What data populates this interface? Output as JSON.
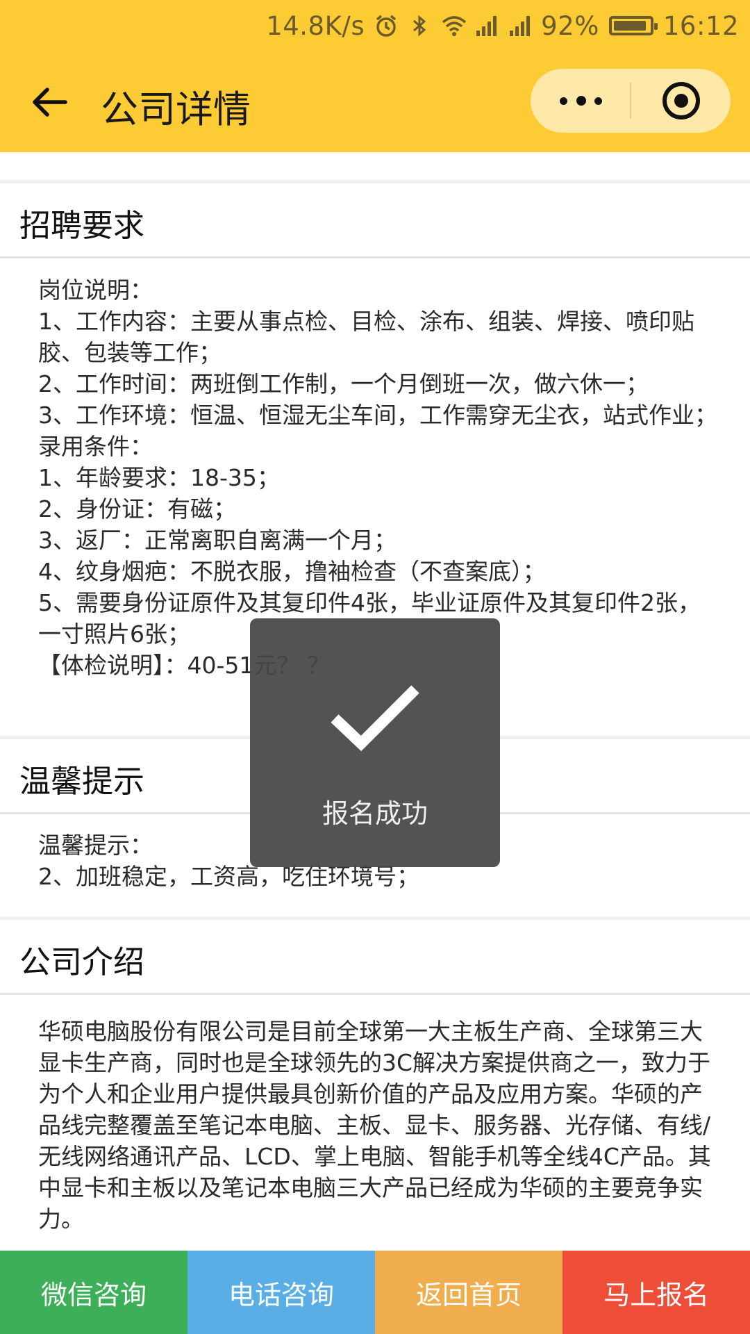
{
  "status_bar": {
    "speed": "14.8K/s",
    "battery": "92%",
    "battery_level": 0.92,
    "time": "16:12",
    "icons": [
      "alarm-icon",
      "bluetooth-icon",
      "wifi-icon",
      "signal-icon",
      "signal-icon",
      "battery-icon"
    ]
  },
  "navbar": {
    "title": "公司详情",
    "back_icon": "arrow-left-icon",
    "more_icon": "more-dots-icon",
    "close_icon": "target-circle-icon",
    "color": "#fdcb34"
  },
  "sections": {
    "requirements": {
      "title": "招聘要求",
      "lines": [
        "岗位说明：",
        "1、工作内容：主要从事点检、目检、涂布、组装、焊接、喷印贴胶、包装等工作；",
        "2、工作时间：两班倒工作制，一个月倒班一次，做六休一；",
        "3、工作环境：恒温、恒湿无尘车间，工作需穿无尘衣，站式作业；",
        "录用条件：",
        "1、年龄要求：18-35；",
        "2、身份证：有磁；",
        "3、返厂：正常离职自离满一个月；",
        "4、纹身烟疤：不脱衣服，撸袖检查（不查案底）；",
        "5、需要身份证原件及其复印件4张，毕业证原件及其复印件2张，一寸照片6张；",
        "【体检说明】：40-51元？ ？"
      ]
    },
    "tips": {
      "title": "温馨提示",
      "lines": [
        "温馨提示：",
        "2、加班稳定，工资高，吃住环境号；"
      ]
    },
    "company": {
      "title": "公司介绍",
      "text": "华硕电脑股份有限公司是目前全球第一大主板生产商、全球第三大显卡生产商，同时也是全球领先的3C解决方案提供商之一，致力于为个人和企业用户提供最具创新价值的产品及应用方案。华硕的产品线完整覆盖至笔记本电脑、主板、显卡、服务器、光存储、有线/无线网络通讯产品、LCD、掌上电脑、智能手机等全线4C产品。其中显卡和主板以及笔记本电脑三大产品已经成为华硕的主要竞争实力。"
    }
  },
  "toast": {
    "icon": "checkmark-icon",
    "message": "报名成功"
  },
  "bottom_bar": [
    {
      "label": "微信咨询",
      "color": "#3daf58"
    },
    {
      "label": "电话咨询",
      "color": "#5aaee6"
    },
    {
      "label": "返回首页",
      "color": "#f0ad4e"
    },
    {
      "label": "马上报名",
      "color": "#ee4e38"
    }
  ]
}
